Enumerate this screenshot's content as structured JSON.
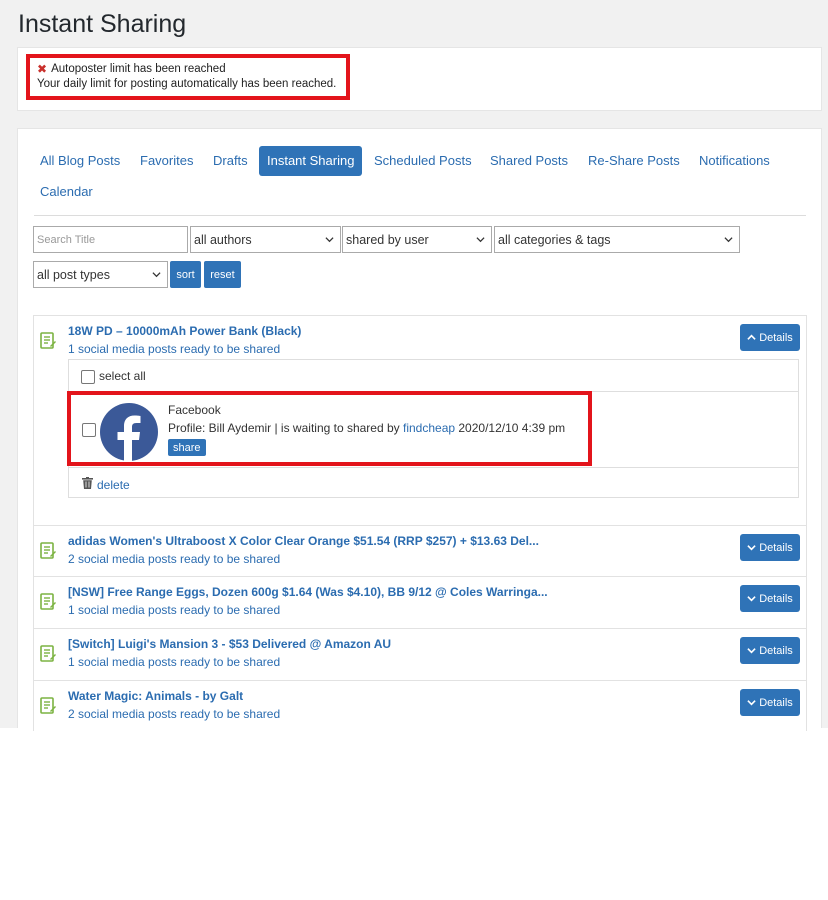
{
  "page": {
    "title": "Instant Sharing"
  },
  "notice": {
    "icon": "close-x-icon",
    "line1": "Autoposter limit has been reached",
    "line2": "Your daily limit for posting automatically has been reached."
  },
  "tabs": [
    {
      "label": "All Blog Posts",
      "active": false
    },
    {
      "label": "Favorites",
      "active": false
    },
    {
      "label": "Drafts",
      "active": false
    },
    {
      "label": "Instant Sharing",
      "active": true
    },
    {
      "label": "Scheduled Posts",
      "active": false
    },
    {
      "label": "Shared Posts",
      "active": false
    },
    {
      "label": "Re-Share Posts",
      "active": false
    },
    {
      "label": "Notifications",
      "active": false
    },
    {
      "label": "Calendar",
      "active": false
    }
  ],
  "filters": {
    "search_placeholder": "Search Title",
    "authors": "all authors",
    "shared_by": "shared by user",
    "categories": "all categories & tags",
    "post_types": "all post types",
    "sort_label": "sort",
    "reset_label": "reset"
  },
  "posts": [
    {
      "title": "18W PD – 10000mAh Power Bank (Black)",
      "subtitle": "1 social media posts ready to be shared",
      "details_label": "Details",
      "expanded": true,
      "select_all_label": "select all",
      "accounts": [
        {
          "network": "Facebook",
          "icon": "facebook-icon",
          "profile_text": "Profile: Bill Aydemir | is waiting to shared by ",
          "user_link": "findcheap",
          "datetime": " 2020/12/10 4:39 pm",
          "share_label": "share"
        }
      ],
      "delete_label": "delete"
    },
    {
      "title": "adidas Women's Ultraboost X Color Clear Orange $51.54 (RRP $257) + $13.63 Del...",
      "subtitle": "2 social media posts ready to be shared",
      "details_label": "Details",
      "expanded": false
    },
    {
      "title": "[NSW] Free Range Eggs, Dozen 600g $1.64 (Was $4.10), BB 9/12 @ Coles Warringa...",
      "subtitle": "1 social media posts ready to be shared",
      "details_label": "Details",
      "expanded": false
    },
    {
      "title": "[Switch] Luigi's Mansion 3 - $53 Delivered @ Amazon AU",
      "subtitle": "1 social media posts ready to be shared",
      "details_label": "Details",
      "expanded": false
    },
    {
      "title": "Water Magic: Animals - by Galt",
      "subtitle": "2 social media posts ready to be shared",
      "details_label": "Details",
      "expanded": false
    }
  ],
  "colors": {
    "accent": "#2f73b7",
    "link": "#2b6cb0",
    "highlight_border": "#e3141b",
    "post_icon": "#7cb342",
    "facebook": "#3b5998"
  }
}
